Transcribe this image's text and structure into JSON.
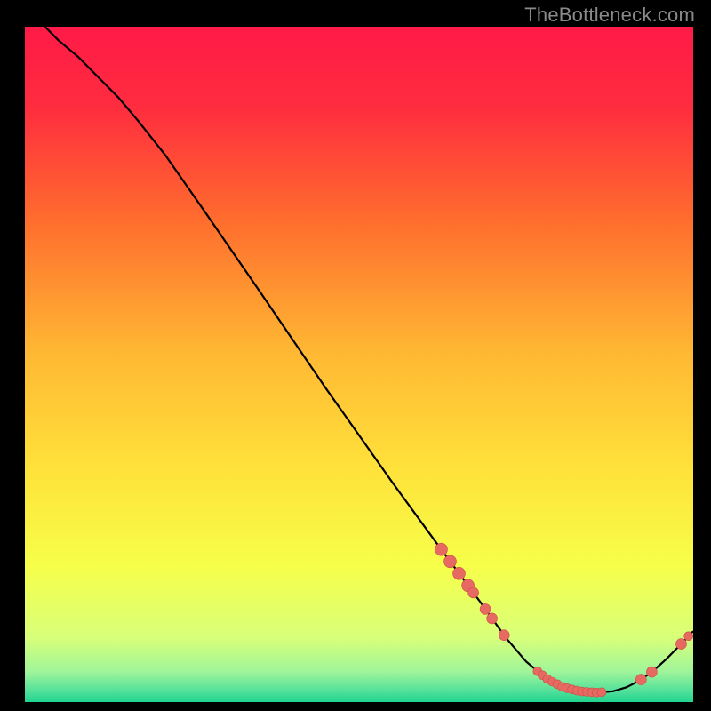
{
  "watermark": "TheBottleneck.com",
  "colors": {
    "bg": "#000000",
    "gradient_stops": [
      {
        "offset": 0.0,
        "color": "#ff1a47"
      },
      {
        "offset": 0.12,
        "color": "#ff2d3f"
      },
      {
        "offset": 0.28,
        "color": "#ff6a2e"
      },
      {
        "offset": 0.48,
        "color": "#ffb733"
      },
      {
        "offset": 0.66,
        "color": "#ffe33a"
      },
      {
        "offset": 0.8,
        "color": "#f6ff4a"
      },
      {
        "offset": 0.905,
        "color": "#d8ff7a"
      },
      {
        "offset": 0.955,
        "color": "#9ff59a"
      },
      {
        "offset": 0.985,
        "color": "#4edf9a"
      },
      {
        "offset": 1.0,
        "color": "#1fd48f"
      }
    ],
    "curve": "#000000",
    "mark_fill": "#e66a62",
    "mark_stroke": "#cc4e48"
  },
  "chart_data": {
    "type": "line",
    "title": "",
    "xlabel": "",
    "ylabel": "",
    "xlim": [
      0,
      100
    ],
    "ylim": [
      0,
      100
    ],
    "curve": [
      {
        "x": 3.0,
        "y": 100.0
      },
      {
        "x": 5.0,
        "y": 98.0
      },
      {
        "x": 8.0,
        "y": 95.5
      },
      {
        "x": 11.0,
        "y": 92.5
      },
      {
        "x": 14.0,
        "y": 89.5
      },
      {
        "x": 17.0,
        "y": 86.0
      },
      {
        "x": 21.0,
        "y": 81.0
      },
      {
        "x": 27.0,
        "y": 72.5
      },
      {
        "x": 35.0,
        "y": 61.0
      },
      {
        "x": 45.0,
        "y": 46.5
      },
      {
        "x": 55.0,
        "y": 32.5
      },
      {
        "x": 62.0,
        "y": 23.0
      },
      {
        "x": 68.0,
        "y": 15.0
      },
      {
        "x": 72.0,
        "y": 9.5
      },
      {
        "x": 75.0,
        "y": 6.0
      },
      {
        "x": 78.0,
        "y": 3.5
      },
      {
        "x": 80.5,
        "y": 2.2
      },
      {
        "x": 83.0,
        "y": 1.6
      },
      {
        "x": 85.5,
        "y": 1.4
      },
      {
        "x": 88.0,
        "y": 1.6
      },
      {
        "x": 90.0,
        "y": 2.2
      },
      {
        "x": 92.0,
        "y": 3.2
      },
      {
        "x": 94.0,
        "y": 4.6
      },
      {
        "x": 96.0,
        "y": 6.4
      },
      {
        "x": 98.0,
        "y": 8.4
      },
      {
        "x": 100.0,
        "y": 10.5
      }
    ],
    "clusters": [
      {
        "cx": 64.3,
        "cy": 20.0,
        "count": 4,
        "spread": 2.0,
        "r": 7
      },
      {
        "cx": 68.0,
        "cy": 15.0,
        "count": 2,
        "spread": 0.9,
        "r": 6
      },
      {
        "cx": 70.8,
        "cy": 11.2,
        "count": 2,
        "spread": 0.9,
        "r": 6
      },
      {
        "cx": 81.5,
        "cy": 2.0,
        "count": 14,
        "spread": 4.8,
        "r": 5
      },
      {
        "cx": 93.0,
        "cy": 4.0,
        "count": 2,
        "spread": 0.8,
        "r": 6
      },
      {
        "cx": 98.2,
        "cy": 8.8,
        "count": 1,
        "spread": 0,
        "r": 6
      },
      {
        "cx": 99.3,
        "cy": 10.0,
        "count": 1,
        "spread": 0,
        "r": 5
      }
    ]
  }
}
